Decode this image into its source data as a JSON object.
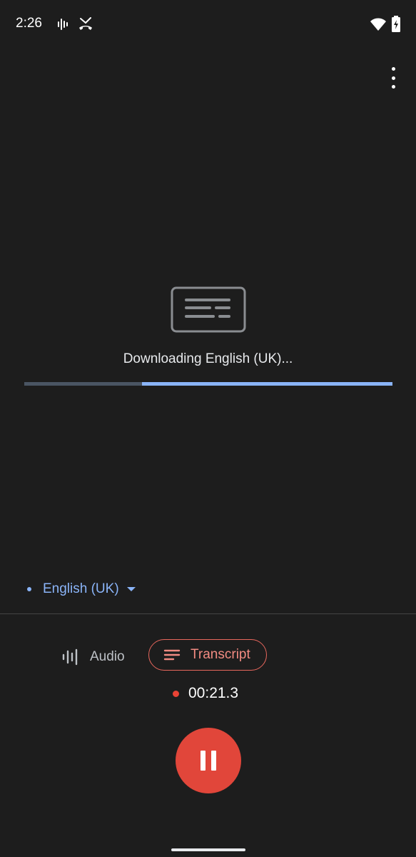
{
  "status_bar": {
    "time": "2:26",
    "icons": [
      "sound-wave-icon",
      "missed-call-icon",
      "wifi-icon",
      "battery-icon"
    ]
  },
  "header": {
    "menu_icon": "more-vert-icon"
  },
  "download": {
    "icon": "transcript-icon",
    "status_text": "Downloading English (UK)...",
    "progress": 0.68
  },
  "language": {
    "label": "English (UK)",
    "icon": "dropdown-arrow-icon"
  },
  "tabs": {
    "audio": {
      "label": "Audio",
      "icon": "waveform-icon",
      "selected": false
    },
    "transcript": {
      "label": "Transcript",
      "icon": "notes-icon",
      "selected": true
    }
  },
  "recording": {
    "elapsed": "00:21.3",
    "pause_icon": "pause-icon"
  },
  "colors": {
    "background": "#1d1d1d",
    "accent_blue": "#8ab4f8",
    "record_red": "#e1463a",
    "transcript_red": "#f28b82"
  }
}
